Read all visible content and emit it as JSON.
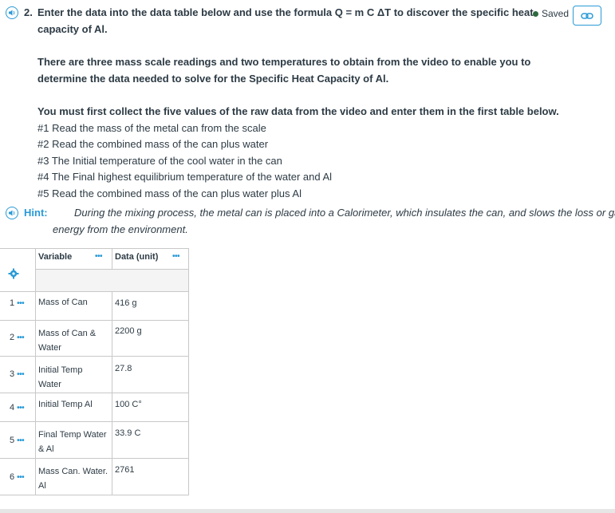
{
  "question": {
    "number": "2.",
    "line1": "Enter the data into the data table below and use the formula Q = m C ΔT to discover the specific heat",
    "line2": "capacity of Al.",
    "intro1": "There are three mass scale readings and two temperatures to obtain from the video to enable you to",
    "intro2": "determine the data needed to solve for the Specific Heat Capacity of Al.",
    "must_collect": "You must first collect the five values of the raw data from the video and enter them in the first table below.",
    "steps": [
      "#1 Read the mass of the metal can from the scale",
      "#2 Read the combined mass of the can plus water",
      "#3 The Initial temperature of the cool water in the can",
      "#4 The Final highest equilibrium temperature of the water and Al",
      "#5 Read the combined mass of the can plus water plus Al"
    ]
  },
  "status": {
    "saved_label": "Saved"
  },
  "hint": {
    "label": "Hint:",
    "line1": "During the mixing process, the metal can is placed into a Calorimeter, which insulates the can, and slows the loss or gain of",
    "line2": "energy from the environment."
  },
  "table": {
    "columns": [
      "Variable",
      "Data (unit)"
    ],
    "rows": [
      {
        "num": "1",
        "variable": [
          "Mass of Can"
        ],
        "data": "416 g"
      },
      {
        "num": "2",
        "variable": [
          "Mass of Can &",
          "Water"
        ],
        "data": "2200 g"
      },
      {
        "num": "3",
        "variable": [
          "Initial Temp",
          "Water"
        ],
        "data": "27.8"
      },
      {
        "num": "4",
        "variable": [
          "Initial Temp Al"
        ],
        "data": "100 C°"
      },
      {
        "num": "5",
        "variable": [
          "Final Temp Water",
          "& Al"
        ],
        "data": "33.9 C"
      },
      {
        "num": "6",
        "variable": [
          "Mass Can. Water.",
          "Al"
        ],
        "data": "2761"
      }
    ]
  },
  "icons": {
    "speaker": "speaker-icon",
    "link": "link-icon",
    "gear": "gear-icon",
    "more": "more-dots-icon"
  },
  "colors": {
    "accent": "#2a9ad6",
    "text": "#2d3b45",
    "saved_dot": "#2d6a3e"
  }
}
